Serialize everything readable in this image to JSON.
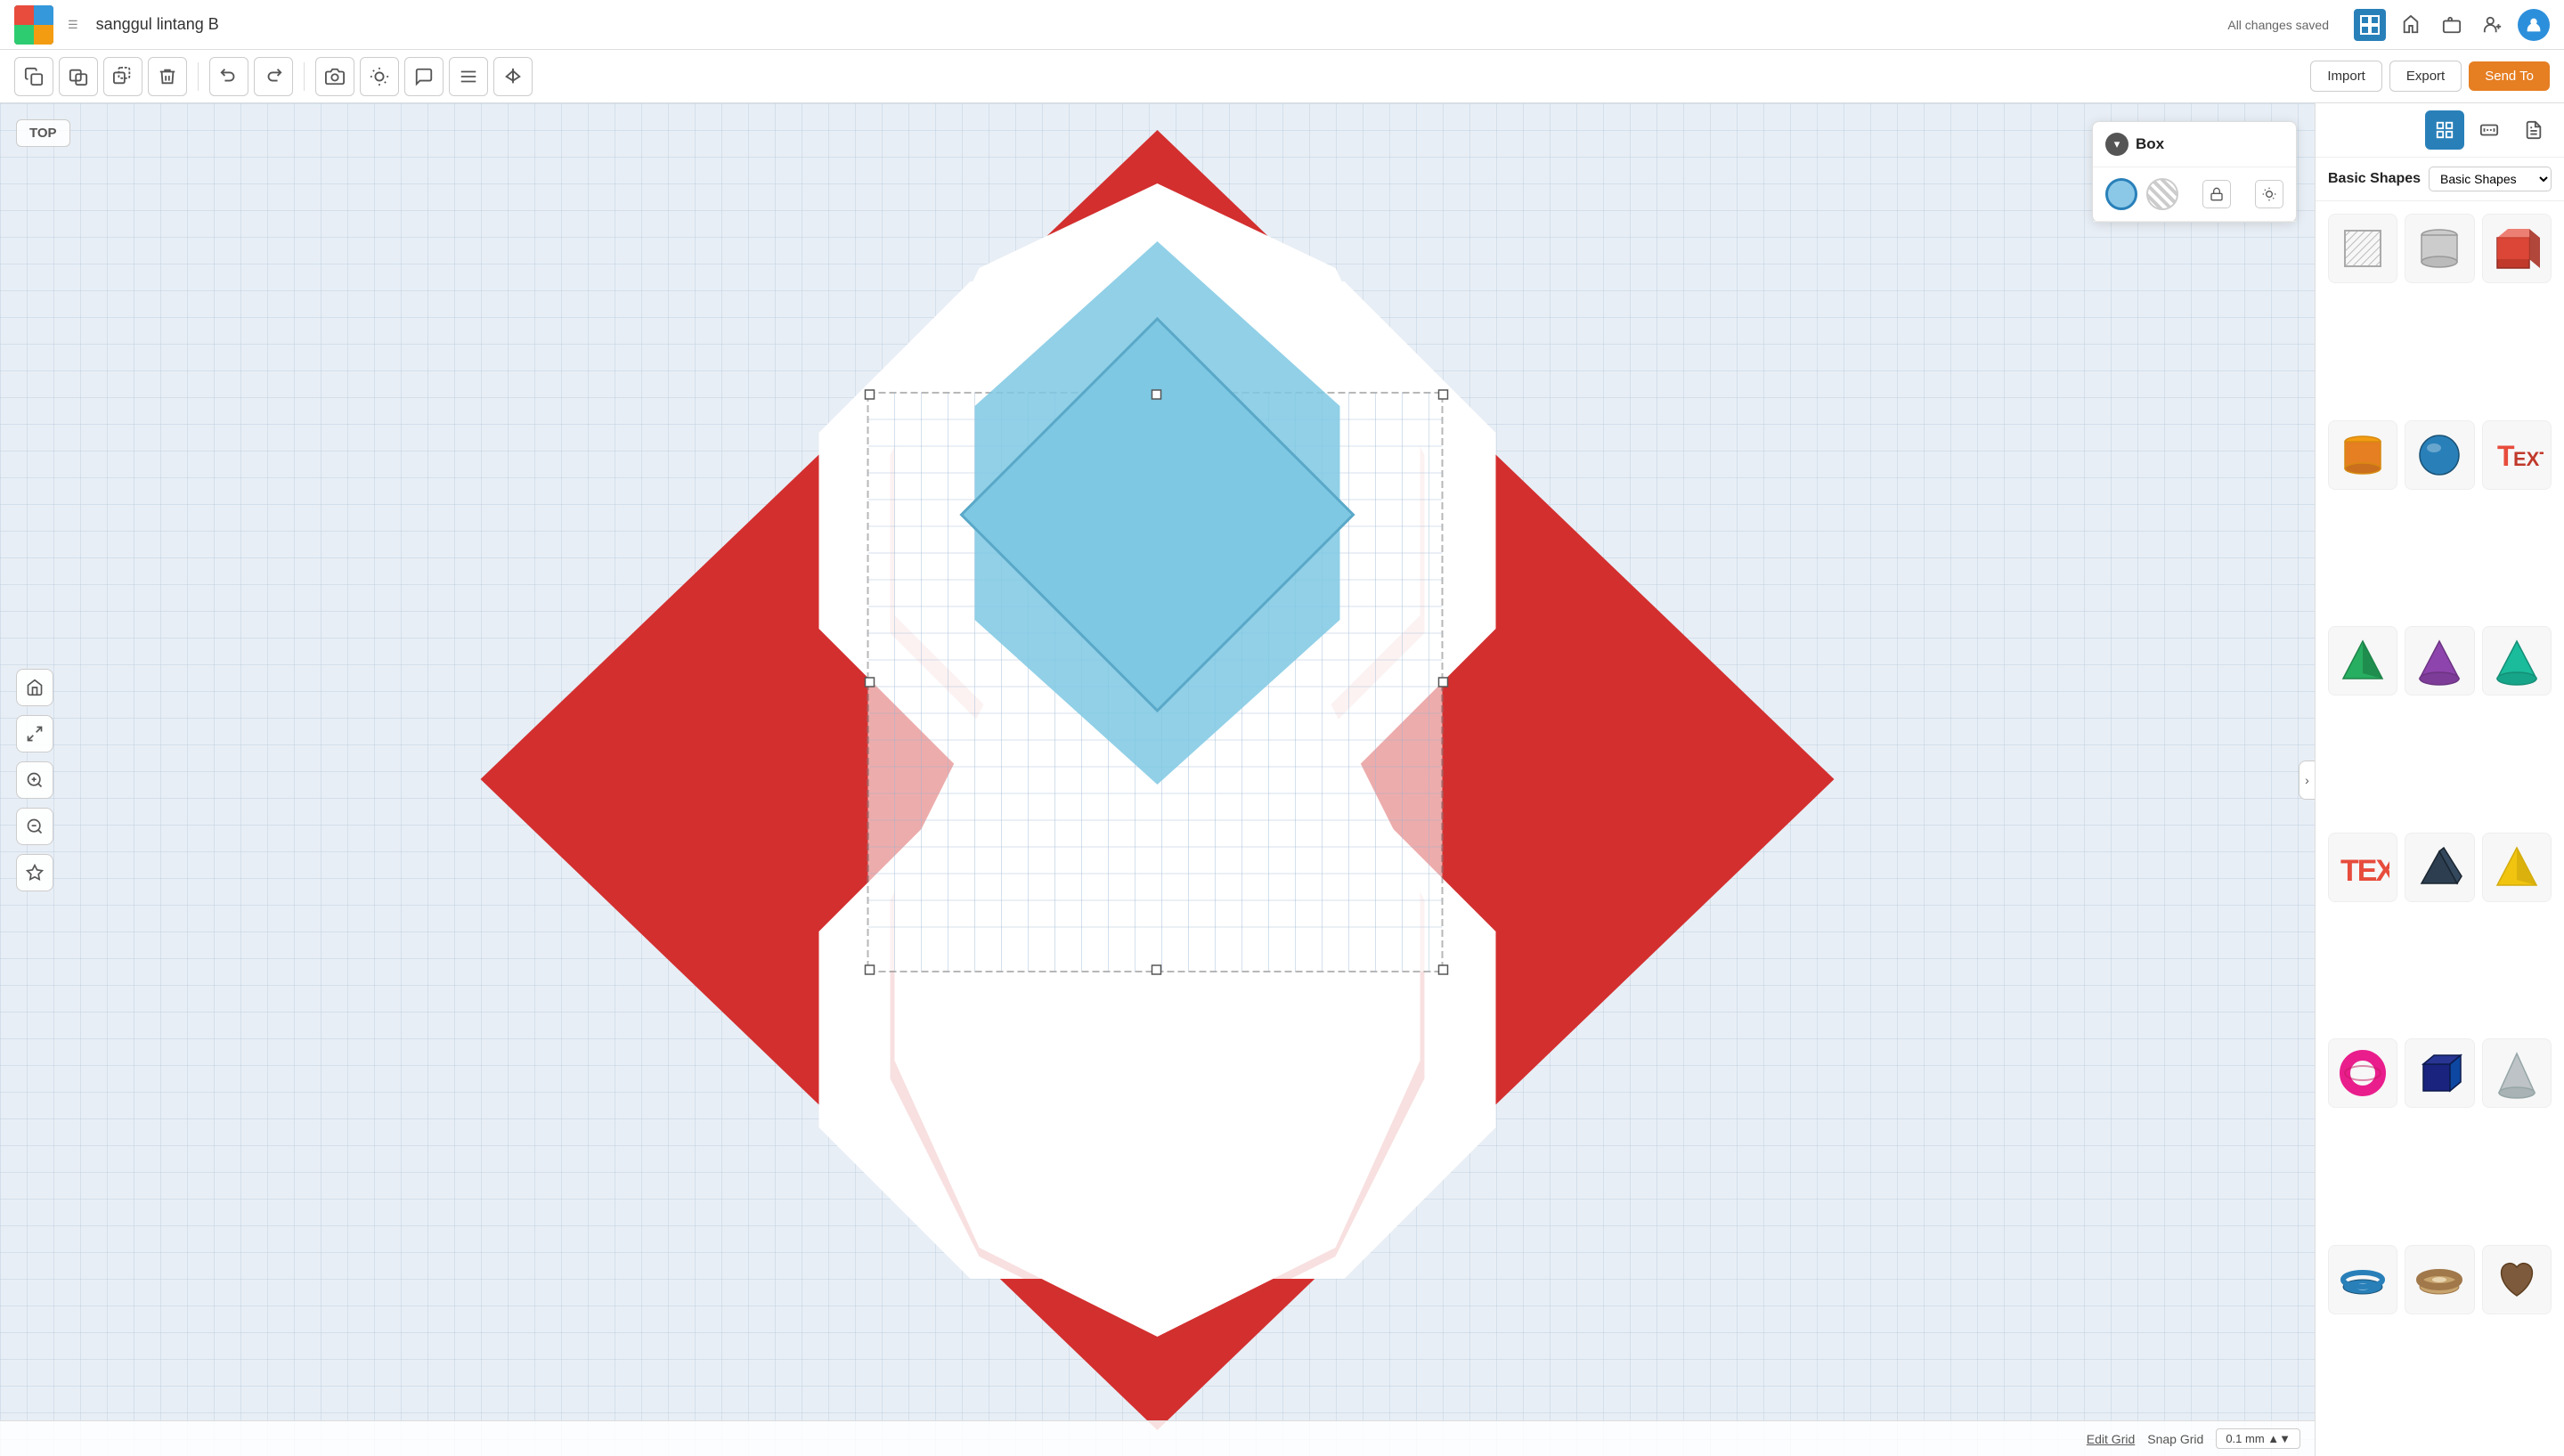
{
  "header": {
    "logo_alt": "TinkerCAD Logo",
    "doc_title": "sanggul lintang B",
    "autosave": "All changes saved",
    "nav_icons": [
      "grid-icon",
      "hammer-icon",
      "briefcase-icon",
      "add-person-icon",
      "avatar-icon"
    ]
  },
  "toolbar": {
    "tools": [
      {
        "name": "copy-tool",
        "label": "⬜",
        "title": "Copy"
      },
      {
        "name": "paste-tool",
        "label": "⬜⬜",
        "title": "Paste"
      },
      {
        "name": "duplicate-tool",
        "label": "❑❑",
        "title": "Duplicate"
      },
      {
        "name": "delete-tool",
        "label": "🗑",
        "title": "Delete"
      },
      {
        "name": "undo-tool",
        "label": "↩",
        "title": "Undo"
      },
      {
        "name": "redo-tool",
        "label": "↪",
        "title": "Redo"
      }
    ],
    "right_tools": [
      {
        "name": "camera-tool",
        "label": "📷"
      },
      {
        "name": "bulb-tool",
        "label": "💡"
      },
      {
        "name": "speech-tool",
        "label": "💬"
      },
      {
        "name": "align-tool",
        "label": "⊞"
      },
      {
        "name": "mirror-tool",
        "label": "⊟"
      }
    ],
    "import_label": "Import",
    "export_label": "Export",
    "sendto_label": "Send To"
  },
  "canvas": {
    "view_label": "TOP"
  },
  "left_controls": [
    {
      "name": "home-btn",
      "icon": "⌂"
    },
    {
      "name": "fullscreen-btn",
      "icon": "⛶"
    },
    {
      "name": "zoom-in-btn",
      "icon": "+"
    },
    {
      "name": "zoom-out-btn",
      "icon": "−"
    },
    {
      "name": "shapes-btn",
      "icon": "✦"
    }
  ],
  "props_panel": {
    "title": "Box",
    "colors": [
      {
        "name": "solid-color",
        "type": "solid"
      },
      {
        "name": "striped-color",
        "type": "striped"
      }
    ],
    "lock_icon": "🔒",
    "bulb_icon": "💡"
  },
  "right_sidebar": {
    "top_icons": [
      {
        "name": "grid-view-icon",
        "label": "⊞",
        "active": true
      },
      {
        "name": "ruler-icon",
        "label": "📐"
      },
      {
        "name": "notes-icon",
        "label": "📋"
      }
    ],
    "shapes_title": "Basic Shapes",
    "dropdown_label": "▾",
    "shapes": [
      {
        "name": "box-shape",
        "color": "#aaa",
        "label": "Box (striped)"
      },
      {
        "name": "cylinder-shape-gray",
        "color": "#aaa",
        "label": "Cylinder (gray)"
      },
      {
        "name": "box-red",
        "color": "#e74c3c",
        "label": "Box (red)"
      },
      {
        "name": "cylinder-orange",
        "color": "#e67e22",
        "label": "Cylinder (orange)"
      },
      {
        "name": "sphere-blue",
        "color": "#2980b9",
        "label": "Sphere (blue)"
      },
      {
        "name": "text-shape",
        "color": "#e74c3c",
        "label": "Text"
      },
      {
        "name": "pyramid-green",
        "color": "#27ae60",
        "label": "Pyramid (green)"
      },
      {
        "name": "cone-purple",
        "color": "#8e44ad",
        "label": "Cone (purple)"
      },
      {
        "name": "cone-teal",
        "color": "#1abc9c",
        "label": "Cone (teal)"
      },
      {
        "name": "wedge-red",
        "color": "#e74c3c",
        "label": "Text 3D"
      },
      {
        "name": "prism-blue",
        "color": "#2c3e50",
        "label": "Prism (blue)"
      },
      {
        "name": "pyramid-yellow",
        "color": "#f1c40f",
        "label": "Pyramid (yellow)"
      },
      {
        "name": "torus-pink",
        "color": "#e91e8c",
        "label": "Torus (pink)"
      },
      {
        "name": "cube-dark",
        "color": "#2c3e50",
        "label": "Cube (dark)"
      },
      {
        "name": "cone-gray",
        "color": "#95a5a6",
        "label": "Cone (gray)"
      },
      {
        "name": "torus-blue",
        "color": "#3498db",
        "label": "Torus (blue)"
      },
      {
        "name": "donut-tan",
        "color": "#c8a46e",
        "label": "Donut (tan)"
      },
      {
        "name": "heart-brown",
        "color": "#7d5a3c",
        "label": "Heart (brown)"
      }
    ]
  },
  "bottom_bar": {
    "edit_grid_label": "Edit Grid",
    "snap_grid_label": "Snap Grid",
    "snap_grid_value": "0.1 mm"
  }
}
